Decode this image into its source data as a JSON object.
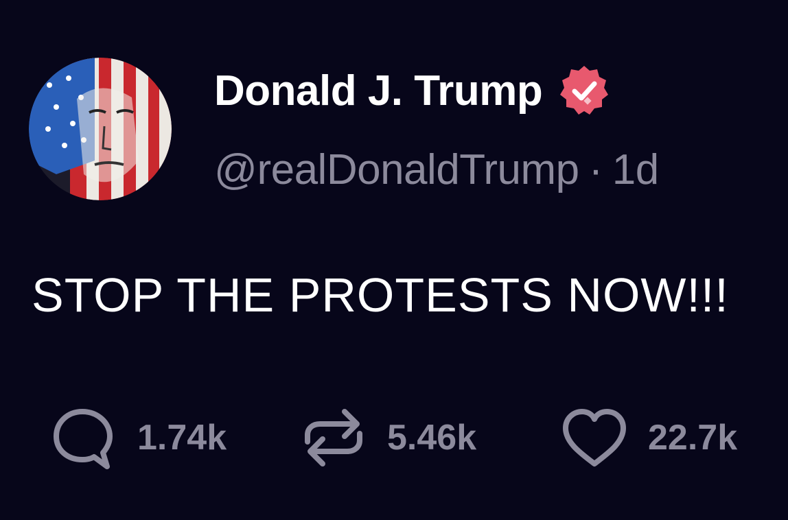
{
  "post": {
    "author": {
      "display_name": "Donald J. Trump",
      "handle": "@realDonaldTrump",
      "verified": true,
      "verified_badge_color": "#e8596e"
    },
    "separator": "·",
    "timestamp": "1d",
    "text": "STOP THE PROTESTS NOW!!!",
    "stats": {
      "replies": "1.74k",
      "reposts": "5.46k",
      "likes": "22.7k"
    }
  },
  "theme": {
    "background": "#07061a",
    "primary_text": "#ffffff",
    "secondary_text": "#8c8a9c"
  },
  "icons": {
    "reply": "speech-bubble-icon",
    "repost": "repost-arrows-icon",
    "like": "heart-icon",
    "verified": "verified-badge-icon"
  }
}
